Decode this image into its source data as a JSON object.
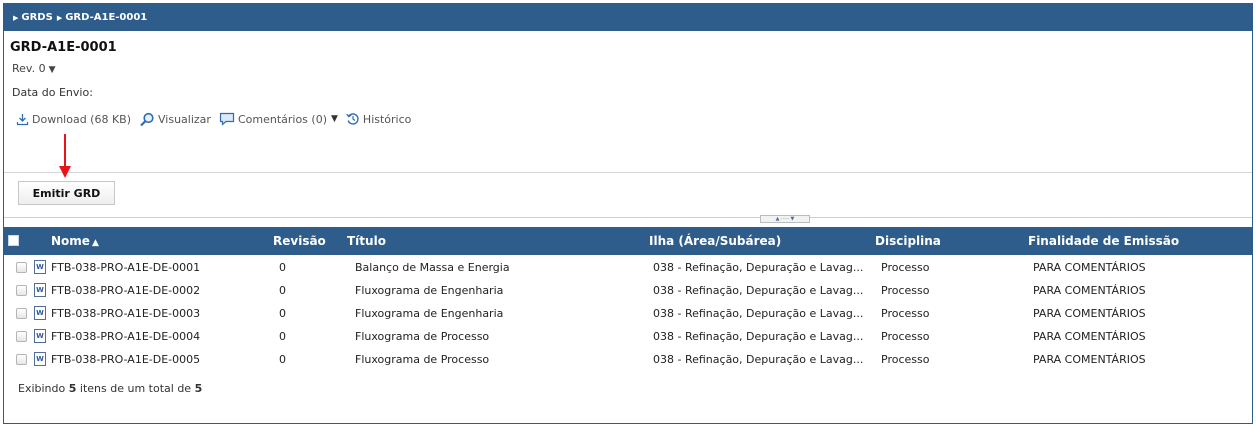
{
  "breadcrumb": [
    {
      "label": "GRDS"
    },
    {
      "label": "GRD-A1E-0001"
    }
  ],
  "document": {
    "title": "GRD-A1E-0001",
    "revision": "Rev. 0",
    "date_label": "Data do Envio:"
  },
  "actions": {
    "download": "Download (68 KB)",
    "view": "Visualizar",
    "comments": "Comentários (0)",
    "history": "Histórico"
  },
  "emit_button": "Emitir GRD",
  "annotation_color": "#e8131b",
  "table": {
    "headers": {
      "name": "Nome",
      "revision": "Revisão",
      "title": "Título",
      "area": "Ilha (Área/Subárea)",
      "discipline": "Disciplina",
      "purpose": "Finalidade de Emissão"
    },
    "rows": [
      {
        "name": "FTB-038-PRO-A1E-DE-0001",
        "revision": "0",
        "title": "Balanço de Massa e Energia",
        "area": "038 - Refinação, Depuração e Lavag...",
        "discipline": "Processo",
        "purpose": "PARA COMENTÁRIOS"
      },
      {
        "name": "FTB-038-PRO-A1E-DE-0002",
        "revision": "0",
        "title": "Fluxograma de Engenharia",
        "area": "038 - Refinação, Depuração e Lavag...",
        "discipline": "Processo",
        "purpose": "PARA COMENTÁRIOS"
      },
      {
        "name": "FTB-038-PRO-A1E-DE-0003",
        "revision": "0",
        "title": "Fluxograma de Engenharia",
        "area": "038 - Refinação, Depuração e Lavag...",
        "discipline": "Processo",
        "purpose": "PARA COMENTÁRIOS"
      },
      {
        "name": "FTB-038-PRO-A1E-DE-0004",
        "revision": "0",
        "title": "Fluxograma de Processo",
        "area": "038 - Refinação, Depuração e Lavag...",
        "discipline": "Processo",
        "purpose": "PARA COMENTÁRIOS"
      },
      {
        "name": "FTB-038-PRO-A1E-DE-0005",
        "revision": "0",
        "title": "Fluxograma de Processo",
        "area": "038 - Refinação, Depuração e Lavag...",
        "discipline": "Processo",
        "purpose": "PARA COMENTÁRIOS"
      }
    ]
  },
  "footer": {
    "prefix": "Exibindo",
    "shown": "5",
    "middle": "itens de um total de",
    "total": "5"
  }
}
